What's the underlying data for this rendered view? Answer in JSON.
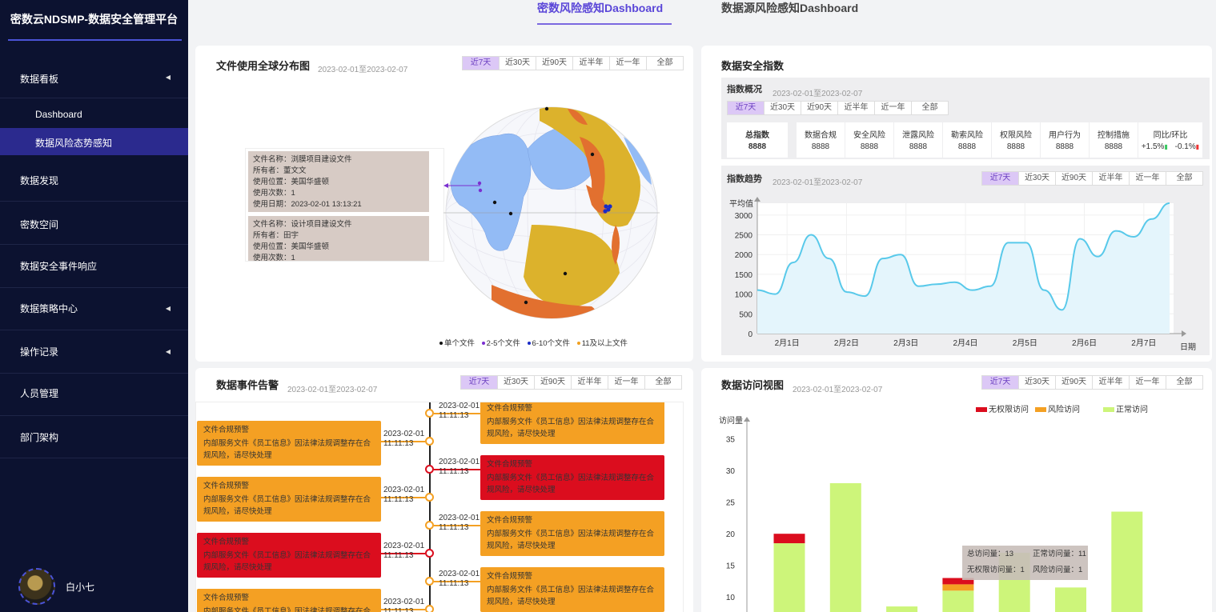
{
  "app": {
    "title": "密数云NDSMP-数据安全管理平台",
    "user": "白小七"
  },
  "tabs": [
    "密数风险感知Dashboard",
    "数据源风险感知Dashboard"
  ],
  "sidebar": {
    "items": [
      "数据看板",
      "Dashboard",
      "数据风险态势感知",
      "数据发现",
      "密数空间",
      "数据安全事件响应",
      "数据策略中心",
      "操作记录",
      "人员管理",
      "部门架构"
    ]
  },
  "ranges": [
    "近7天",
    "近30天",
    "近90天",
    "近半年",
    "近一年",
    "全部"
  ],
  "map": {
    "title": "文件使用全球分布图",
    "date": "2023-02-01至2023-02-07",
    "tips": [
      [
        "文件名称：浏膜项目建设文件",
        "所有者：董文文",
        "使用位置：美国华盛顿",
        "使用次数：1",
        "使用日期：2023-02-01 13:13:21"
      ],
      [
        "文件名称：设计项目建设文件",
        "所有者：田宇",
        "使用位置：美国华盛顿",
        "使用次数：1"
      ]
    ],
    "legend": [
      "单个文件",
      "2-5个文件",
      "6-10个文件",
      "11及以上文件"
    ],
    "legend_colors": [
      "#111111",
      "#7b2fd0",
      "#1a2cc7",
      "#f0a020"
    ]
  },
  "security": {
    "title": "数据安全指数",
    "overview": "指数概况",
    "overview_date": "2023-02-01至2023-02-07",
    "total_label": "总指数",
    "total_value": "8888",
    "cols": [
      {
        "h": "数据合规",
        "v": "8888"
      },
      {
        "h": "安全风险",
        "v": "8888"
      },
      {
        "h": "泄露风险",
        "v": "8888"
      },
      {
        "h": "勒索风险",
        "v": "8888"
      },
      {
        "h": "权限风险",
        "v": "8888"
      },
      {
        "h": "用户行为",
        "v": "8888"
      },
      {
        "h": "控制措施",
        "v": "8888"
      }
    ],
    "ratio_label": "同比/环比",
    "ratio_up": "+1.5%",
    "ratio_down": "-0.1%"
  },
  "trend": {
    "title": "指数趋势",
    "date": "2023-02-01至2023-02-07"
  },
  "events": {
    "title": "数据事件告警",
    "date": "2023-02-01至2023-02-07",
    "items": [
      {
        "side": "right",
        "level": "o",
        "title": "文件合规预警",
        "desc": "内部服务文件《员工信息》因法律法规调整存在合规风险，请尽快处理",
        "date": "2023-02-01",
        "time": "11:11:13"
      },
      {
        "side": "left",
        "level": "o",
        "title": "文件合规预警",
        "desc": "内部服务文件《员工信息》因法律法规调整存在合规风险，请尽快处理",
        "date": "2023-02-01",
        "time": "11:11:13"
      },
      {
        "side": "right",
        "level": "r",
        "title": "文件合规预警",
        "desc": "内部服务文件《员工信息》因法律法规调整存在合规风险，请尽快处理",
        "date": "2023-02-01",
        "time": "11:11:13"
      },
      {
        "side": "left",
        "level": "o",
        "title": "文件合规预警",
        "desc": "内部服务文件《员工信息》因法律法规调整存在合规风险，请尽快处理",
        "date": "2023-02-01",
        "time": "11:11:13"
      },
      {
        "side": "right",
        "level": "o",
        "title": "文件合规预警",
        "desc": "内部服务文件《员工信息》因法律法规调整存在合规风险，请尽快处理",
        "date": "2023-02-01",
        "time": "11:11:13"
      },
      {
        "side": "left",
        "level": "r",
        "title": "文件合规预警",
        "desc": "内部服务文件《员工信息》因法律法规调整存在合规风险，请尽快处理",
        "date": "2023-02-01",
        "time": "11:11:13"
      },
      {
        "side": "right",
        "level": "o",
        "title": "文件合规预警",
        "desc": "内部服务文件《员工信息》因法律法规调整存在合规风险，请尽快处理",
        "date": "2023-02-01",
        "time": "11:11:13"
      },
      {
        "side": "left",
        "level": "o",
        "title": "文件合规预警",
        "desc": "内部服务文件《员工信息》因法律法规调整存在合规风险，请尽快处理",
        "date": "2023-02-01",
        "time": "11:11:13"
      }
    ]
  },
  "access": {
    "title": "数据访问视图",
    "date": "2023-02-01至2023-02-07",
    "tooltip": [
      "总访问量：13",
      "正常访问量：11",
      "无权限访问量：1",
      "风险访问量：1"
    ]
  },
  "chart_data": [
    {
      "type": "line",
      "title": "指数趋势",
      "ylabel": "平均值",
      "xlabel": "日期",
      "categories": [
        "2月1日",
        "2月2日",
        "2月3日",
        "2月4日",
        "2月5日",
        "2月6日",
        "2月7日"
      ],
      "yticks": [
        0,
        500,
        1000,
        1500,
        2000,
        2500,
        3000
      ],
      "ylim": [
        0,
        3300
      ],
      "x": [
        0,
        0.3,
        0.6,
        0.9,
        1.2,
        1.5,
        1.8,
        2.1,
        2.4,
        2.7,
        3.0,
        3.3,
        3.6,
        3.9,
        4.2,
        4.5,
        4.8,
        5.1,
        5.4,
        5.7,
        6.0,
        6.3,
        6.6,
        6.9
      ],
      "series": [
        {
          "values": [
            1100,
            1000,
            1800,
            2500,
            1900,
            1050,
            950,
            1900,
            2000,
            1200,
            1250,
            1300,
            1100,
            1200,
            2300,
            2300,
            1100,
            600,
            2400,
            1950,
            2600,
            2450,
            2900,
            3300
          ]
        }
      ],
      "colors": [
        "#58c9ea"
      ]
    },
    {
      "type": "bar",
      "title": "数据访问视图",
      "ylabel": "访问量",
      "yticks": [
        10,
        15,
        20,
        25,
        30,
        35
      ],
      "ylim": [
        8,
        38
      ],
      "series": [
        {
          "name": "无权限访问",
          "color": "#db0d1e",
          "values": [
            1.5,
            0,
            0,
            1,
            0,
            0,
            0
          ]
        },
        {
          "name": "风险访问",
          "color": "#f4a023",
          "values": [
            0,
            0,
            0,
            1,
            0,
            0,
            0
          ]
        },
        {
          "name": "正常访问",
          "color": "#cdf57a",
          "values": [
            18.5,
            28,
            8.5,
            11,
            17,
            11.5,
            23.5
          ]
        }
      ]
    }
  ]
}
